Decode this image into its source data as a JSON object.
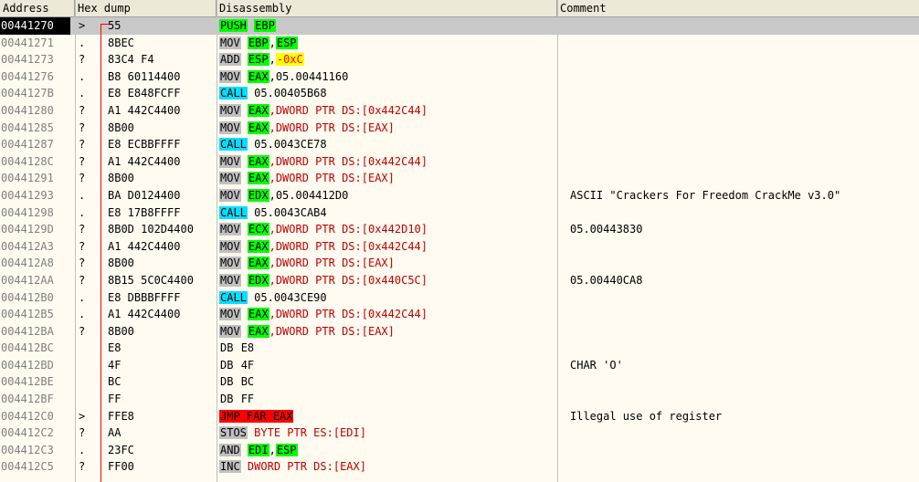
{
  "columns": [
    "Address",
    "Hex dump",
    "Disassembly",
    "Comment"
  ],
  "rows": [
    {
      "addr": "00441270",
      "mark": ">",
      "hex": "55",
      "mn": "PUSH",
      "mc": "m-green",
      "ops": [
        {
          "t": "EBP",
          "c": "r-green"
        }
      ],
      "comment": "",
      "selected": true
    },
    {
      "addr": "00441271",
      "mark": ".",
      "hex": "8BEC",
      "mn": "MOV",
      "mc": "m-gray",
      "ops": [
        {
          "t": "EBP",
          "c": "r-green"
        },
        {
          "t": ",",
          "c": "sep"
        },
        {
          "t": "ESP",
          "c": "r-green"
        }
      ],
      "comment": ""
    },
    {
      "addr": "00441273",
      "mark": "?",
      "hex": "83C4 F4",
      "mn": "ADD",
      "mc": "m-gray",
      "ops": [
        {
          "t": "ESP",
          "c": "r-green"
        },
        {
          "t": ",",
          "c": "sep"
        },
        {
          "t": "-0xC",
          "c": "o-yellow"
        }
      ],
      "comment": ""
    },
    {
      "addr": "00441276",
      "mark": ".",
      "hex": "B8 60114400",
      "mn": "MOV",
      "mc": "m-gray",
      "ops": [
        {
          "t": "EAX",
          "c": "r-green"
        },
        {
          "t": ",05.00441160",
          "c": "o-black"
        }
      ],
      "comment": ""
    },
    {
      "addr": "0044127B",
      "mark": ".",
      "hex": "E8 E848FCFF",
      "mn": "CALL",
      "mc": "m-cyan",
      "ops": [
        {
          "t": "05.00405B68",
          "c": "o-black"
        }
      ],
      "comment": ""
    },
    {
      "addr": "00441280",
      "mark": "?",
      "hex": "A1 442C4400",
      "mn": "MOV",
      "mc": "m-gray",
      "ops": [
        {
          "t": "EAX",
          "c": "r-green"
        },
        {
          "t": ",DWORD PTR DS:[0x442C44]",
          "c": "o-red"
        }
      ],
      "comment": ""
    },
    {
      "addr": "00441285",
      "mark": "?",
      "hex": "8B00",
      "mn": "MOV",
      "mc": "m-gray",
      "ops": [
        {
          "t": "EAX",
          "c": "r-green"
        },
        {
          "t": ",DWORD PTR DS:[EAX]",
          "c": "o-red"
        }
      ],
      "comment": ""
    },
    {
      "addr": "00441287",
      "mark": "?",
      "hex": "E8 ECBBFFFF",
      "mn": "CALL",
      "mc": "m-cyan",
      "ops": [
        {
          "t": "05.0043CE78",
          "c": "o-black"
        }
      ],
      "comment": ""
    },
    {
      "addr": "0044128C",
      "mark": "?",
      "hex": "A1 442C4400",
      "mn": "MOV",
      "mc": "m-gray",
      "ops": [
        {
          "t": "EAX",
          "c": "r-green"
        },
        {
          "t": ",DWORD PTR DS:[0x442C44]",
          "c": "o-red"
        }
      ],
      "comment": ""
    },
    {
      "addr": "00441291",
      "mark": "?",
      "hex": "8B00",
      "mn": "MOV",
      "mc": "m-gray",
      "ops": [
        {
          "t": "EAX",
          "c": "r-green"
        },
        {
          "t": ",DWORD PTR DS:[EAX]",
          "c": "o-red"
        }
      ],
      "comment": ""
    },
    {
      "addr": "00441293",
      "mark": ".",
      "hex": "BA D0124400",
      "mn": "MOV",
      "mc": "m-gray",
      "ops": [
        {
          "t": "EDX",
          "c": "r-green"
        },
        {
          "t": ",05.004412D0",
          "c": "o-black"
        }
      ],
      "comment": "ASCII \"Crackers For Freedom CrackMe v3.0\""
    },
    {
      "addr": "00441298",
      "mark": ".",
      "hex": "E8 17B8FFFF",
      "mn": "CALL",
      "mc": "m-cyan",
      "ops": [
        {
          "t": "05.0043CAB4",
          "c": "o-black"
        }
      ],
      "comment": ""
    },
    {
      "addr": "0044129D",
      "mark": "?",
      "hex": "8B0D 102D4400",
      "mn": "MOV",
      "mc": "m-gray",
      "ops": [
        {
          "t": "ECX",
          "c": "r-green"
        },
        {
          "t": ",DWORD PTR DS:[0x442D10]",
          "c": "o-red"
        }
      ],
      "comment": "05.00443830"
    },
    {
      "addr": "004412A3",
      "mark": "?",
      "hex": "A1 442C4400",
      "mn": "MOV",
      "mc": "m-gray",
      "ops": [
        {
          "t": "EAX",
          "c": "r-green"
        },
        {
          "t": ",DWORD PTR DS:[0x442C44]",
          "c": "o-red"
        }
      ],
      "comment": ""
    },
    {
      "addr": "004412A8",
      "mark": "?",
      "hex": "8B00",
      "mn": "MOV",
      "mc": "m-gray",
      "ops": [
        {
          "t": "EAX",
          "c": "r-green"
        },
        {
          "t": ",DWORD PTR DS:[EAX]",
          "c": "o-red"
        }
      ],
      "comment": ""
    },
    {
      "addr": "004412AA",
      "mark": "?",
      "hex": "8B15 5C0C4400",
      "mn": "MOV",
      "mc": "m-gray",
      "ops": [
        {
          "t": "EDX",
          "c": "r-green"
        },
        {
          "t": ",DWORD PTR DS:[0x440C5C]",
          "c": "o-red"
        }
      ],
      "comment": "05.00440CA8"
    },
    {
      "addr": "004412B0",
      "mark": ".",
      "hex": "E8 DBBBFFFF",
      "mn": "CALL",
      "mc": "m-cyan",
      "ops": [
        {
          "t": "05.0043CE90",
          "c": "o-black"
        }
      ],
      "comment": ""
    },
    {
      "addr": "004412B5",
      "mark": ".",
      "hex": "A1 442C4400",
      "mn": "MOV",
      "mc": "m-gray",
      "ops": [
        {
          "t": "EAX",
          "c": "r-green"
        },
        {
          "t": ",DWORD PTR DS:[0x442C44]",
          "c": "o-red"
        }
      ],
      "comment": ""
    },
    {
      "addr": "004412BA",
      "mark": "?",
      "hex": "8B00",
      "mn": "MOV",
      "mc": "m-gray",
      "ops": [
        {
          "t": "EAX",
          "c": "r-green"
        },
        {
          "t": ",DWORD PTR DS:[EAX]",
          "c": "o-red"
        }
      ],
      "comment": ""
    },
    {
      "addr": "004412BC",
      "mark": "",
      "hex": "E8",
      "mn": "DB",
      "mc": "m-plain",
      "ops": [
        {
          "t": "E8",
          "c": "o-black"
        }
      ],
      "comment": ""
    },
    {
      "addr": "004412BD",
      "mark": "",
      "hex": "4F",
      "mn": "DB",
      "mc": "m-plain",
      "ops": [
        {
          "t": "4F",
          "c": "o-black"
        }
      ],
      "comment": "CHAR 'O'"
    },
    {
      "addr": "004412BE",
      "mark": "",
      "hex": "BC",
      "mn": "DB",
      "mc": "m-plain",
      "ops": [
        {
          "t": "BC",
          "c": "o-black"
        }
      ],
      "comment": ""
    },
    {
      "addr": "004412BF",
      "mark": "",
      "hex": "FF",
      "mn": "DB",
      "mc": "m-plain",
      "ops": [
        {
          "t": "FF",
          "c": "o-black"
        }
      ],
      "comment": ""
    },
    {
      "addr": "004412C0",
      "mark": ">",
      "hex": "FFE8",
      "mn": "JMP FAR EAX",
      "mc": "m-red",
      "ops": [],
      "comment": "Illegal use of register"
    },
    {
      "addr": "004412C2",
      "mark": "?",
      "hex": "AA",
      "mn": "STOS",
      "mc": "m-gray",
      "ops": [
        {
          "t": "BYTE PTR ES:[EDI]",
          "c": "o-red"
        }
      ],
      "comment": ""
    },
    {
      "addr": "004412C3",
      "mark": ".",
      "hex": "23FC",
      "mn": "AND",
      "mc": "m-gray",
      "ops": [
        {
          "t": "EDI",
          "c": "r-green"
        },
        {
          "t": ",",
          "c": "sep"
        },
        {
          "t": "ESP",
          "c": "r-green"
        }
      ],
      "comment": ""
    },
    {
      "addr": "004412C5",
      "mark": "?",
      "hex": "FF00",
      "mn": "INC",
      "mc": "m-gray",
      "ops": [
        {
          "t": "DWORD PTR DS:[EAX]",
          "c": "o-red"
        }
      ],
      "comment": ""
    }
  ],
  "colors": {
    "background": "#fffbf0",
    "call": "#00e0ff",
    "jump": "#ff0000",
    "register": "#00ff00",
    "memory_operand": "#c00000",
    "immediate_highlight": "#ffff00"
  }
}
